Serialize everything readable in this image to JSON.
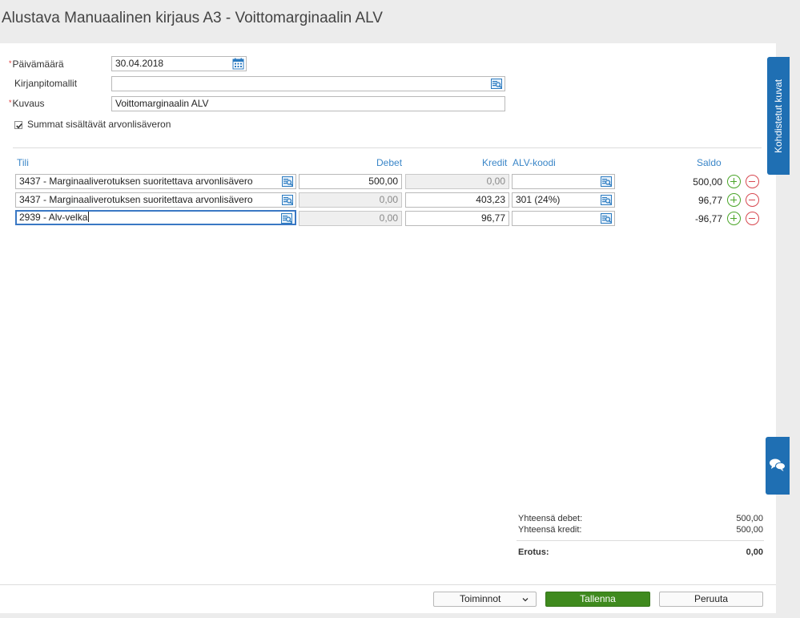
{
  "title": "Alustava Manuaalinen kirjaus A3  -  Voittomarginaalin ALV",
  "form": {
    "required_mark": "*",
    "date_label": "Päivämäärä",
    "date_value": "30.04.2018",
    "templates_label": "Kirjanpitomallit",
    "templates_value": "",
    "description_label": "Kuvaus",
    "description_value": "Voittomarginaalin ALV",
    "vat_included_label": "Summat sisältävät arvonlisäveron",
    "vat_included_checked": true
  },
  "table": {
    "headers": {
      "account": "Tili",
      "debit": "Debet",
      "credit": "Kredit",
      "vat_code": "ALV-koodi",
      "balance": "Saldo"
    },
    "rows": [
      {
        "account": "3437 - Marginaaliverotuksen suoritettava arvonlisävero",
        "debit": "500,00",
        "credit": "0,00",
        "vat_code": "",
        "balance": "500,00"
      },
      {
        "account": "3437 - Marginaaliverotuksen suoritettava arvonlisävero",
        "debit": "0,00",
        "credit": "403,23",
        "vat_code": "301 (24%)",
        "balance": "96,77"
      },
      {
        "account": "2939 - Alv-velka",
        "debit": "0,00",
        "credit": "96,77",
        "vat_code": "",
        "balance": "-96,77"
      }
    ]
  },
  "sidebar": {
    "attached_images_label": "Kohdistetut kuvat"
  },
  "summary": {
    "total_debit_label": "Yhteensä debet:",
    "total_debit_value": "500,00",
    "total_credit_label": "Yhteensä kredit:",
    "total_credit_value": "500,00",
    "difference_label": "Erotus:",
    "difference_value": "0,00"
  },
  "footer": {
    "actions_label": "Toiminnot",
    "save_label": "Tallenna",
    "cancel_label": "Peruuta"
  },
  "colors": {
    "accent": "#3a86c8",
    "primary_button": "#3f8a1e",
    "side_tab": "#1f6fb3",
    "add": "#4aa528",
    "remove": "#d84850",
    "required": "#dd3333"
  },
  "icons": [
    "calendar-icon",
    "lookup-icon",
    "checkbox-check-icon",
    "add-row-icon",
    "remove-row-icon",
    "chat-icon",
    "chevron-down-icon"
  ]
}
